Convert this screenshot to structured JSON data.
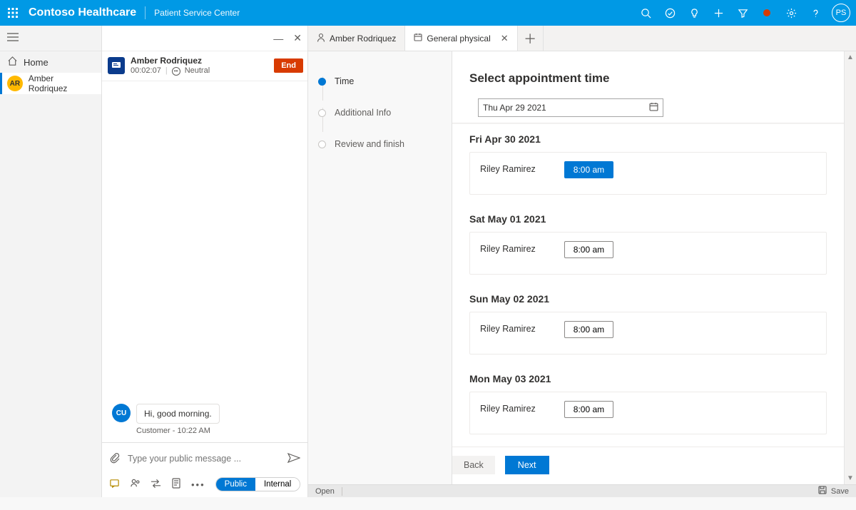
{
  "header": {
    "brand": "Contoso Healthcare",
    "appname": "Patient Service Center",
    "profile_initials": "PS"
  },
  "nav": {
    "home": "Home",
    "patient_initials": "AR",
    "patient_name": "Amber Rodriquez"
  },
  "session": {
    "name": "Amber Rodriquez",
    "timer": "00:02:07",
    "sentiment": "Neutral",
    "end_label": "End"
  },
  "chat": {
    "customer_initials": "CU",
    "message": "Hi, good morning.",
    "meta": "Customer - 10:22 AM",
    "placeholder": "Type your public message ...",
    "seg_public": "Public",
    "seg_internal": "Internal"
  },
  "tabs": {
    "tab1": "Amber Rodriquez",
    "tab2": "General physical"
  },
  "steps": {
    "s1": "Time",
    "s2": "Additional Info",
    "s3": "Review and finish"
  },
  "appointment": {
    "title": "Select appointment time",
    "date_value": "Thu Apr 29 2021",
    "days": [
      {
        "date": "Fri Apr 30 2021",
        "practitioner": "Riley Ramirez",
        "slot": "8:00 am",
        "selected": true
      },
      {
        "date": "Sat May 01 2021",
        "practitioner": "Riley Ramirez",
        "slot": "8:00 am",
        "selected": false
      },
      {
        "date": "Sun May 02 2021",
        "practitioner": "Riley Ramirez",
        "slot": "8:00 am",
        "selected": false
      },
      {
        "date": "Mon May 03 2021",
        "practitioner": "Riley Ramirez",
        "slot": "8:00 am",
        "selected": false
      }
    ],
    "back": "Back",
    "next": "Next"
  },
  "statusbar": {
    "open": "Open",
    "save": "Save"
  }
}
